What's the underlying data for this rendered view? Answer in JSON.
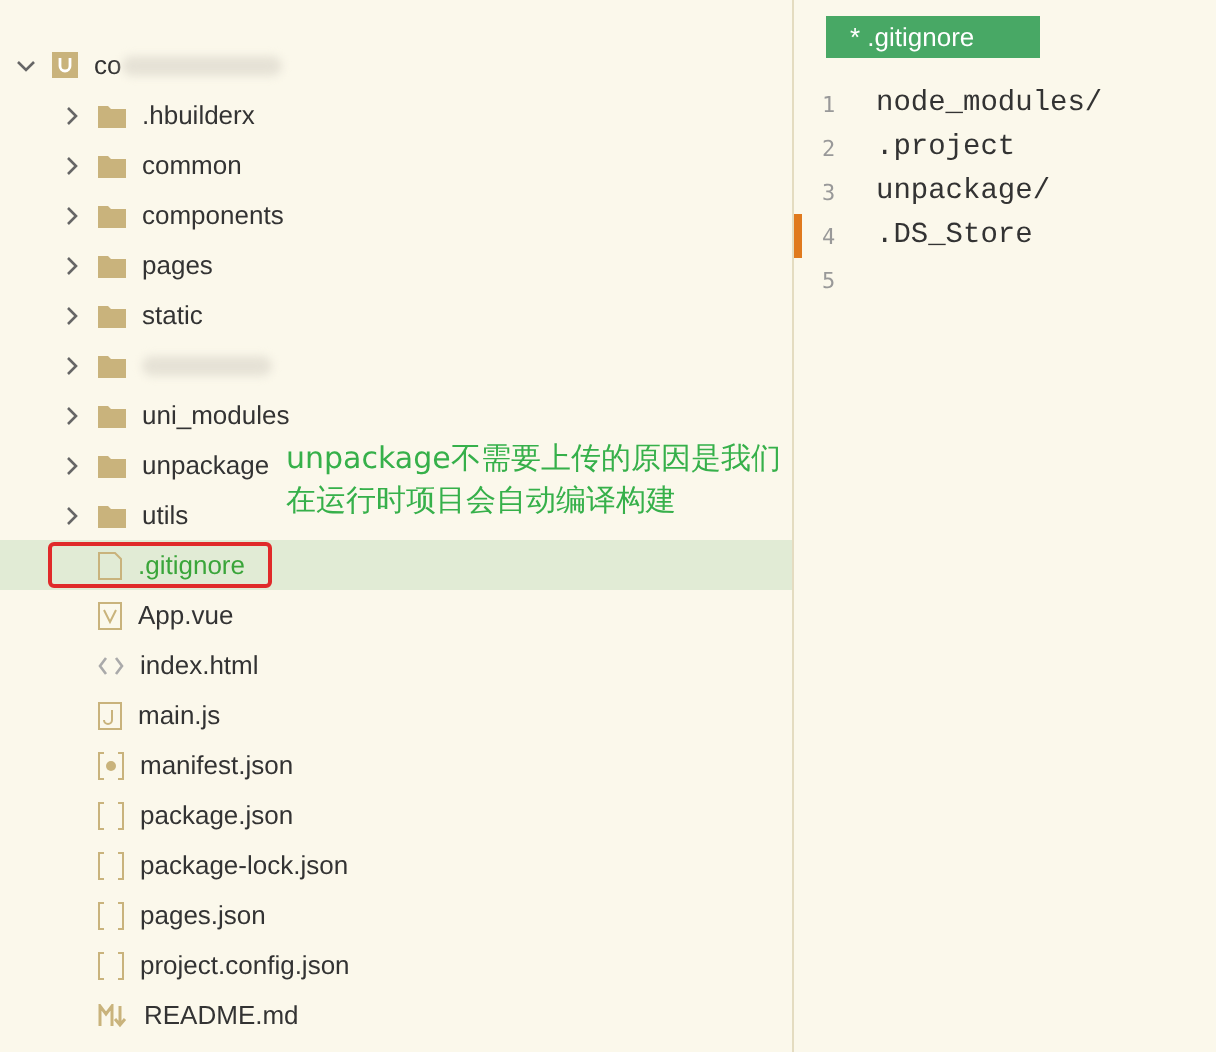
{
  "explorer": {
    "root": {
      "label": "co",
      "blurred": true,
      "expanded": true,
      "children": [
        {
          "kind": "folder",
          "label": ".hbuilderx",
          "expanded": false,
          "selected": false,
          "highlighted": false
        },
        {
          "kind": "folder",
          "label": "common",
          "expanded": false,
          "selected": false,
          "highlighted": false
        },
        {
          "kind": "folder",
          "label": "components",
          "expanded": false,
          "selected": false,
          "highlighted": false
        },
        {
          "kind": "folder",
          "label": "pages",
          "expanded": false,
          "selected": false,
          "highlighted": false
        },
        {
          "kind": "folder",
          "label": "static",
          "expanded": false,
          "selected": false,
          "highlighted": false
        },
        {
          "kind": "folder",
          "blurred": true,
          "expanded": false,
          "selected": false,
          "highlighted": false
        },
        {
          "kind": "folder",
          "label": "uni_modules",
          "expanded": false,
          "selected": false,
          "highlighted": false
        },
        {
          "kind": "folder",
          "label": "unpackage",
          "expanded": false,
          "selected": false,
          "highlighted": false
        },
        {
          "kind": "folder",
          "label": "utils",
          "expanded": false,
          "selected": false,
          "highlighted": false
        },
        {
          "kind": "text",
          "label": ".gitignore",
          "selected": true,
          "highlighted": true
        },
        {
          "kind": "vue",
          "label": "App.vue",
          "selected": false,
          "highlighted": false
        },
        {
          "kind": "html",
          "label": "index.html",
          "selected": false,
          "highlighted": false
        },
        {
          "kind": "js",
          "label": "main.js",
          "selected": false,
          "highlighted": false
        },
        {
          "kind": "manifest",
          "label": "manifest.json",
          "selected": false,
          "highlighted": false
        },
        {
          "kind": "json",
          "label": "package.json",
          "selected": false,
          "highlighted": false
        },
        {
          "kind": "json",
          "label": "package-lock.json",
          "selected": false,
          "highlighted": false
        },
        {
          "kind": "json",
          "label": "pages.json",
          "selected": false,
          "highlighted": false
        },
        {
          "kind": "json",
          "label": "project.config.json",
          "selected": false,
          "highlighted": false
        },
        {
          "kind": "markdown",
          "label": "README.md",
          "selected": false,
          "highlighted": false
        }
      ]
    }
  },
  "annotation": {
    "lines": [
      "unpackage不需要上传的原因是我们",
      "在运行时项目会自动编译构建"
    ]
  },
  "editor": {
    "tab": {
      "label": "* .gitignore",
      "selected": true
    },
    "lines": [
      {
        "number": "1",
        "text": "node_modules/",
        "changed": false
      },
      {
        "number": "2",
        "text": ".project",
        "changed": false
      },
      {
        "number": "3",
        "text": "unpackage/",
        "changed": false
      },
      {
        "number": "4",
        "text": ".DS_Store",
        "changed": true
      },
      {
        "number": "5",
        "changed": false
      }
    ]
  }
}
